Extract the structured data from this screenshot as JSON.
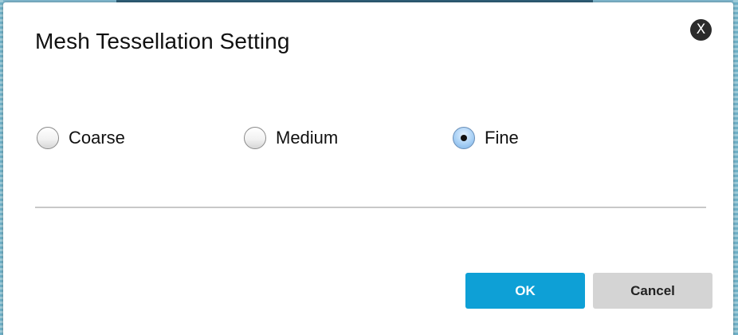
{
  "dialog": {
    "title": "Mesh Tessellation Setting",
    "close_label": "X"
  },
  "options": [
    {
      "label": "Coarse",
      "checked": false
    },
    {
      "label": "Medium",
      "checked": false
    },
    {
      "label": "Fine",
      "checked": true
    }
  ],
  "buttons": {
    "ok_label": "OK",
    "cancel_label": "Cancel"
  },
  "colors": {
    "ok_button": "#0ea0d6",
    "cancel_button": "#d4d4d4",
    "close_button": "#2b2b2b"
  }
}
